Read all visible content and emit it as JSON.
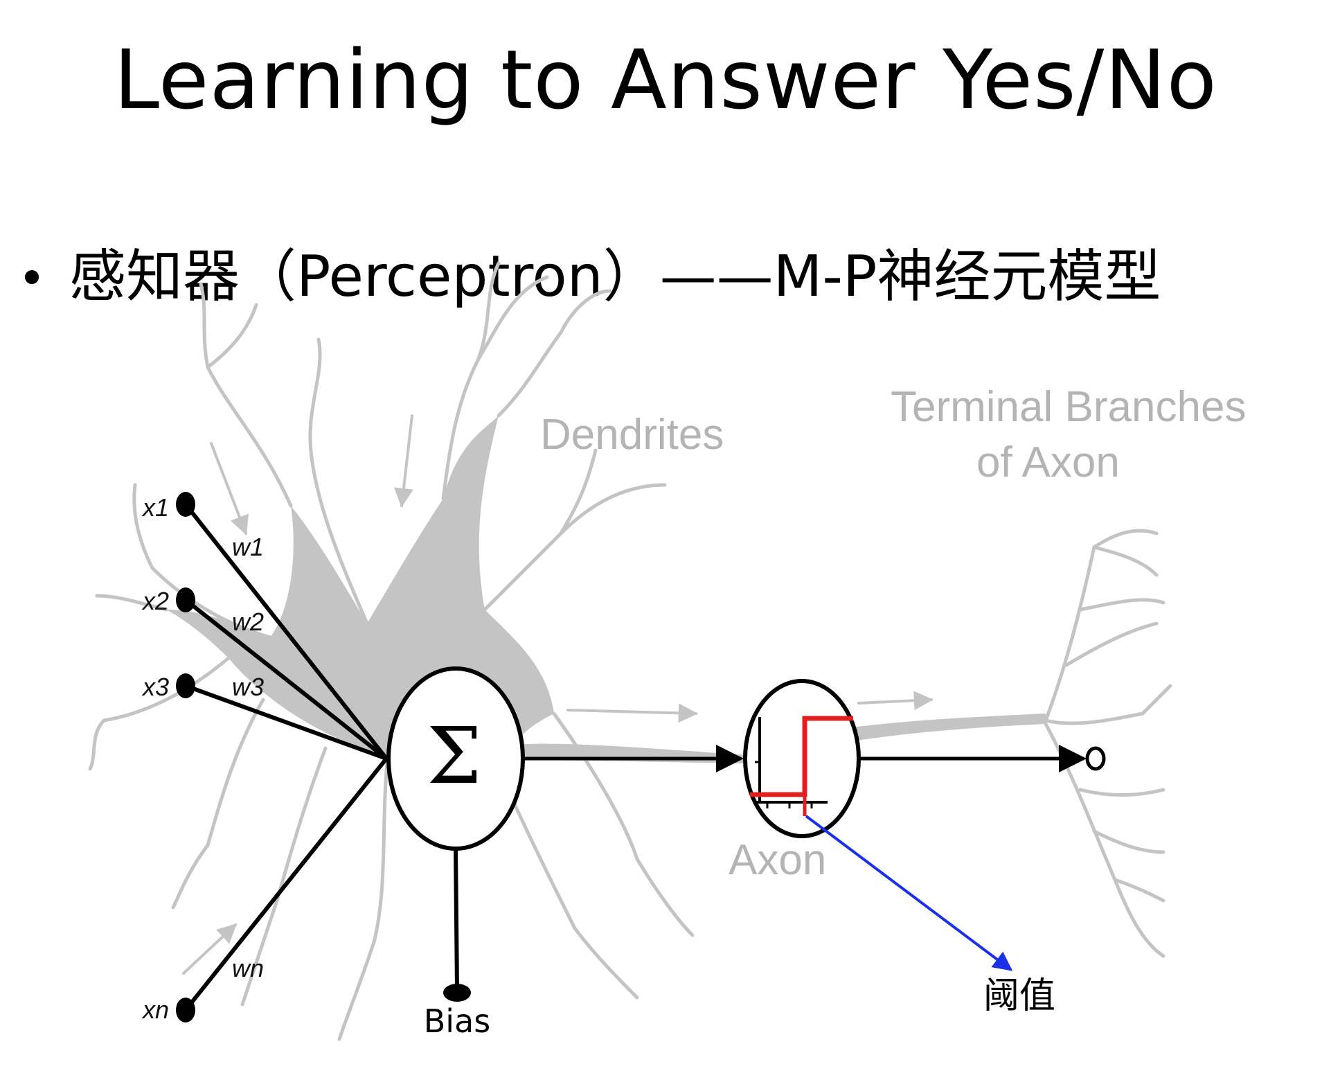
{
  "title": "Learning to Answer Yes/No",
  "bullet": "感知器（Perceptron）——M-P神经元模型",
  "diagram": {
    "inputs": [
      {
        "label": "x1",
        "weight": "w1"
      },
      {
        "label": "x2",
        "weight": "w2"
      },
      {
        "label": "x3",
        "weight": "w3"
      },
      {
        "label": "xn",
        "weight": "wn"
      }
    ],
    "sum_symbol": "Σ",
    "bias_label": "Bias",
    "dendrites_label": "Dendrites",
    "terminal_label_line1": "Terminal Branches",
    "terminal_label_line2": "of Axon",
    "axon_label": "Axon",
    "threshold_label": "阈值",
    "colors": {
      "neuron_gray": "#c4c4c4",
      "threshold_red": "#e02020",
      "threshold_arrow_blue": "#1a30e8",
      "line_black": "#000000"
    }
  }
}
